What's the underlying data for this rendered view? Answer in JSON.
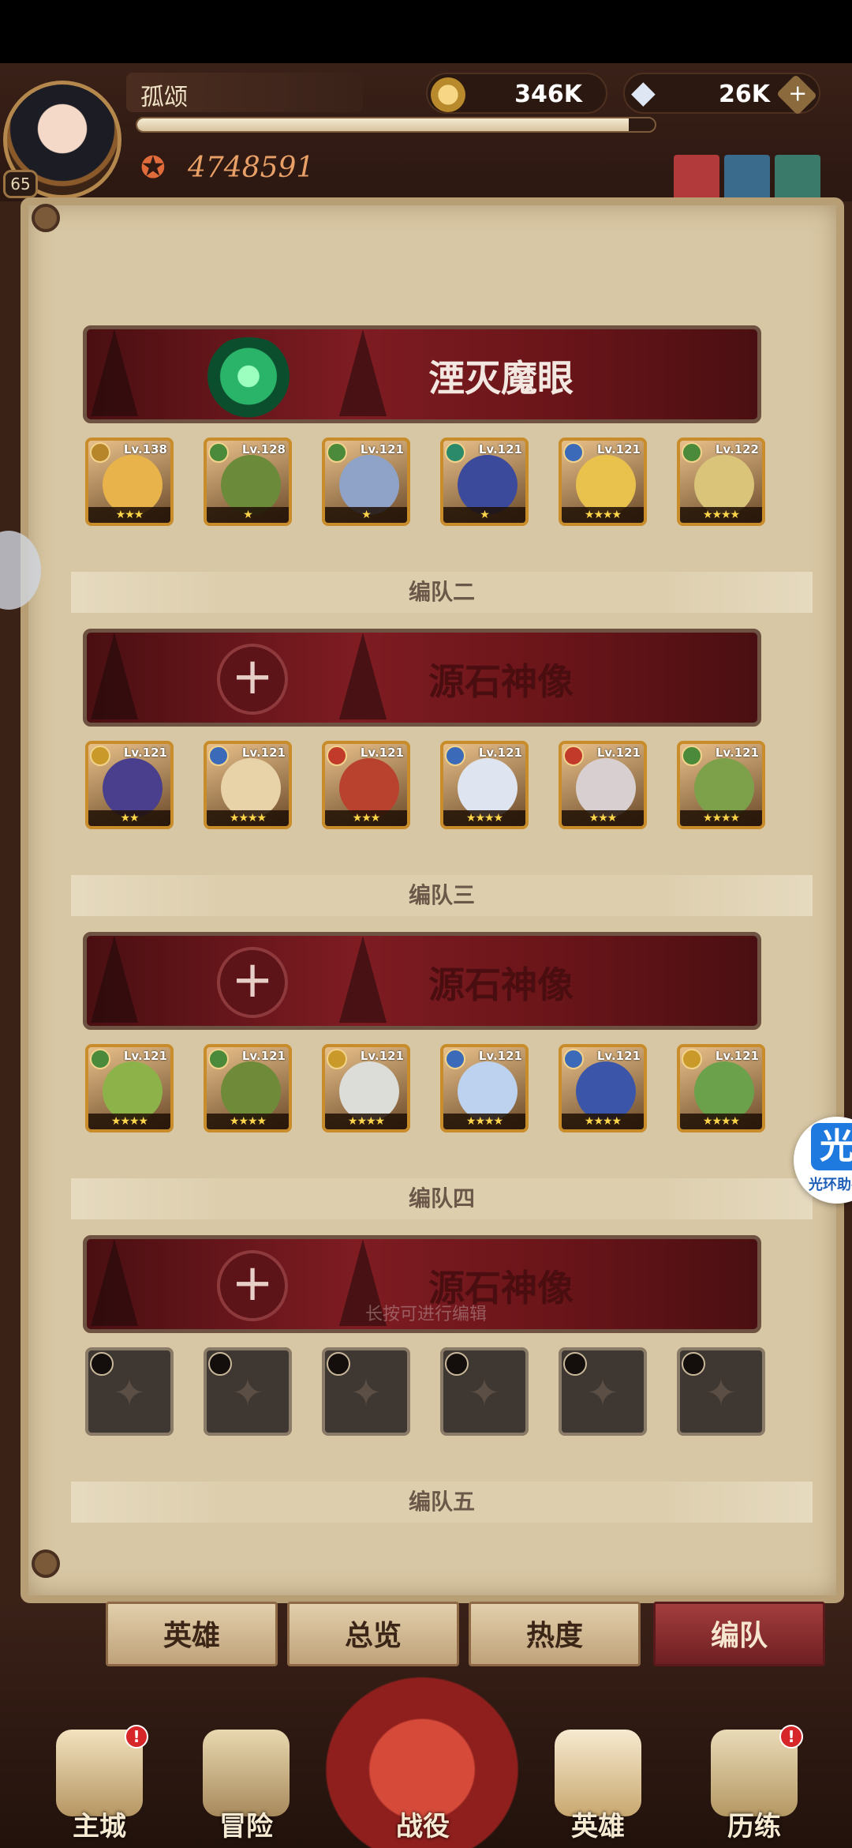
{
  "player": {
    "name": "孤颂",
    "level": "65",
    "power": "4748591",
    "xp_fraction": 0.95
  },
  "currency": {
    "gold": "346K",
    "gems": "26K",
    "add_label": "+"
  },
  "teams": [
    {
      "label": "",
      "banner": "湮灭魔眼",
      "heroes": [
        {
          "level": "Lv.138",
          "stars": "★★★",
          "color": "#e8b34a"
        },
        {
          "level": "Lv.128",
          "stars": "★",
          "color": "#6b8b3a"
        },
        {
          "level": "Lv.121",
          "stars": "★",
          "color": "#8fa3c8"
        },
        {
          "level": "Lv.121",
          "stars": "★",
          "color": "#3b4a9a"
        },
        {
          "level": "Lv.121",
          "stars": "★★★★",
          "color": "#e9c24d"
        },
        {
          "level": "Lv.122",
          "stars": "★★★★",
          "color": "#d9c47a"
        }
      ]
    },
    {
      "label": "编队二",
      "banner": "源石神像",
      "heroes": [
        {
          "level": "Lv.121",
          "stars": "★★",
          "color": "#4a3f8c"
        },
        {
          "level": "Lv.121",
          "stars": "★★★★",
          "color": "#e8d2a8"
        },
        {
          "level": "Lv.121",
          "stars": "★★★",
          "color": "#b8422e"
        },
        {
          "level": "Lv.121",
          "stars": "★★★★",
          "color": "#dfe5f0"
        },
        {
          "level": "Lv.121",
          "stars": "★★★",
          "color": "#d8d0d0"
        },
        {
          "level": "Lv.121",
          "stars": "★★★★",
          "color": "#7da04a"
        }
      ]
    },
    {
      "label": "编队三",
      "banner": "源石神像",
      "heroes": [
        {
          "level": "Lv.121",
          "stars": "★★★★",
          "color": "#8eb24a"
        },
        {
          "level": "Lv.121",
          "stars": "★★★★",
          "color": "#6f8b3a"
        },
        {
          "level": "Lv.121",
          "stars": "★★★★",
          "color": "#dcdcd8"
        },
        {
          "level": "Lv.121",
          "stars": "★★★★",
          "color": "#bcd2ee"
        },
        {
          "level": "Lv.121",
          "stars": "★★★★",
          "color": "#3b56a8"
        },
        {
          "level": "Lv.121",
          "stars": "★★★★",
          "color": "#6aa14a"
        }
      ]
    },
    {
      "label": "编队四",
      "banner": "源石神像",
      "heroes": []
    },
    {
      "label": "编队五"
    }
  ],
  "hint": "长按可进行编辑",
  "assistant": {
    "glyph": "光",
    "label": "光环助手"
  },
  "tabs": [
    "英雄",
    "总览",
    "热度",
    "编队"
  ],
  "active_tab": "编队",
  "nav": [
    "主城",
    "冒险",
    "战役",
    "英雄",
    "历练"
  ],
  "colors": {
    "accent": "#7e1c22",
    "paper": "#e6dabf",
    "gold": "#c88c2a"
  }
}
